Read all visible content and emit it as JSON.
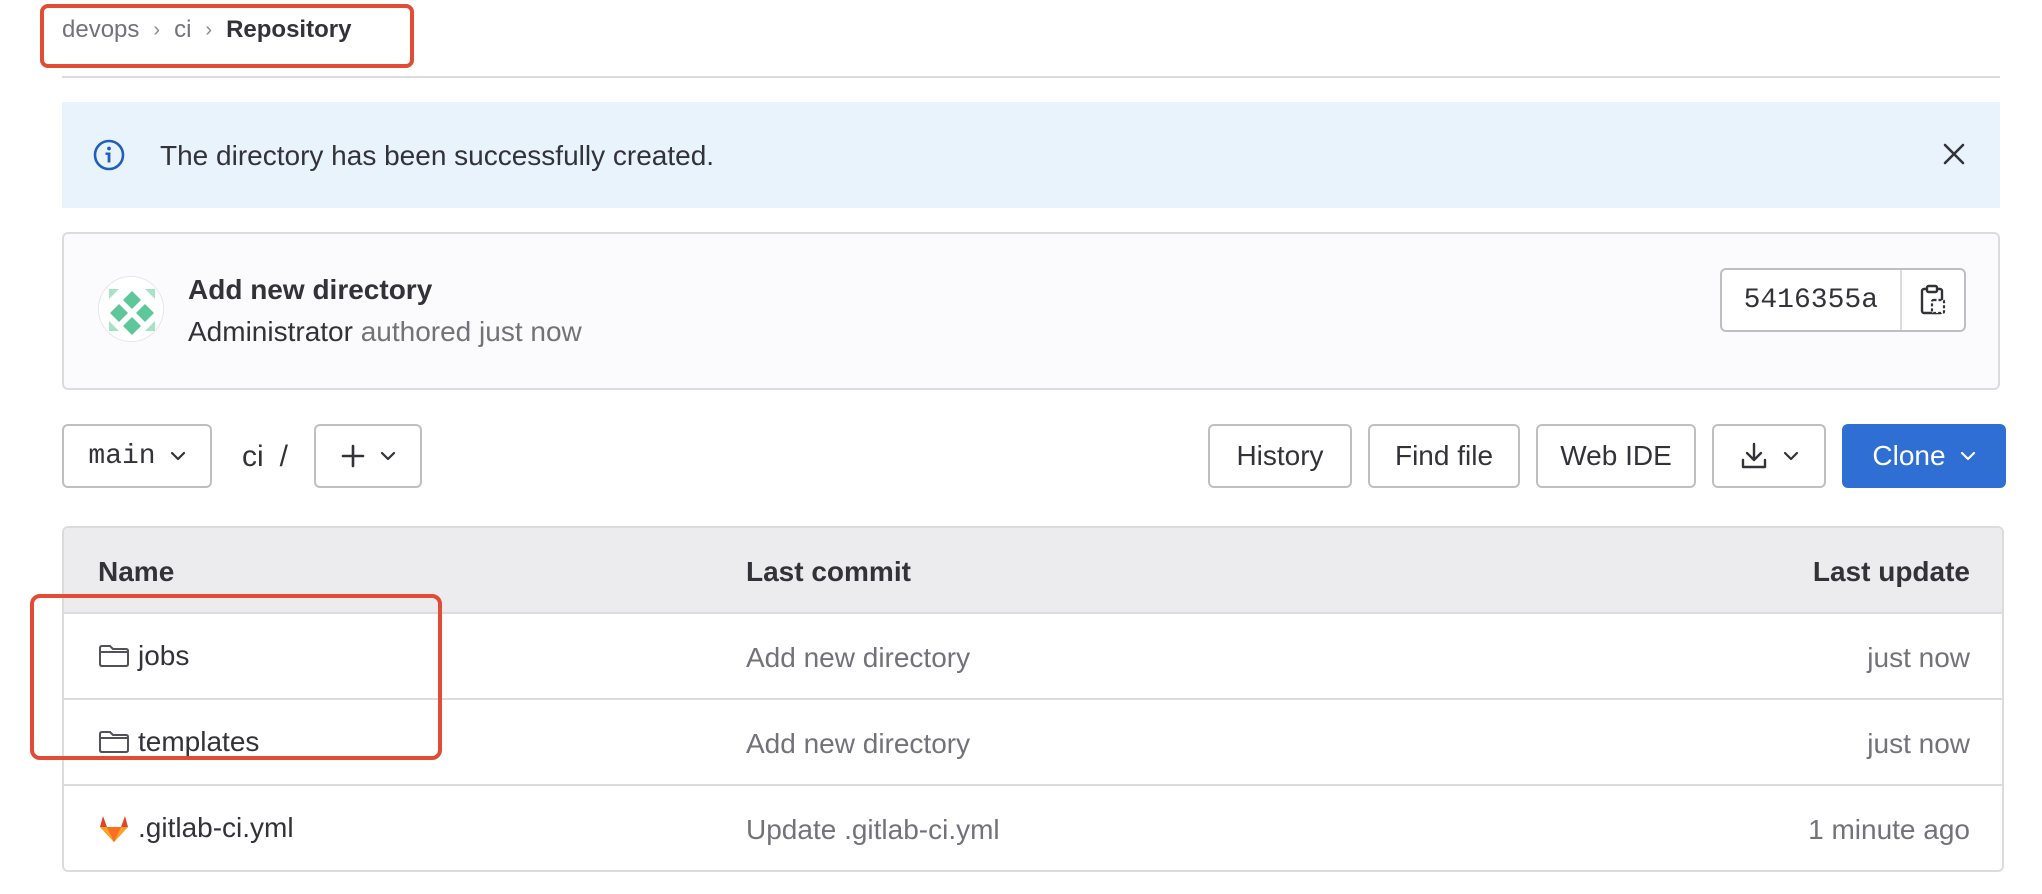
{
  "breadcrumb": {
    "items": [
      "devops",
      "ci",
      "Repository"
    ]
  },
  "alert": {
    "message": "The directory has been successfully created.",
    "icons": [
      "info-icon",
      "close-icon"
    ]
  },
  "commit": {
    "title": "Add new directory",
    "author": "Administrator",
    "meta": "authored just now",
    "sha": "5416355a",
    "copy_icon": "clipboard-icon"
  },
  "toolbar": {
    "branch": "main",
    "path": "ci",
    "path_sep": "/",
    "history": "History",
    "find_file": "Find file",
    "web_ide": "Web IDE",
    "download_icon": "download-icon",
    "clone": "Clone"
  },
  "table": {
    "headers": [
      "Name",
      "Last commit",
      "Last update"
    ],
    "rows": [
      {
        "icon": "folder-icon",
        "name": "jobs",
        "commit": "Add new directory",
        "updated": "just now"
      },
      {
        "icon": "folder-icon",
        "name": "templates",
        "commit": "Add new directory",
        "updated": "just now"
      },
      {
        "icon": "gitlab-icon",
        "name": ".gitlab-ci.yml",
        "commit": "Update .gitlab-ci.yml",
        "updated": "1 minute ago"
      }
    ]
  },
  "colors": {
    "accent": "#2f6fd4",
    "alert_bg": "#e9f3fc",
    "annotation": "#e24b34"
  }
}
